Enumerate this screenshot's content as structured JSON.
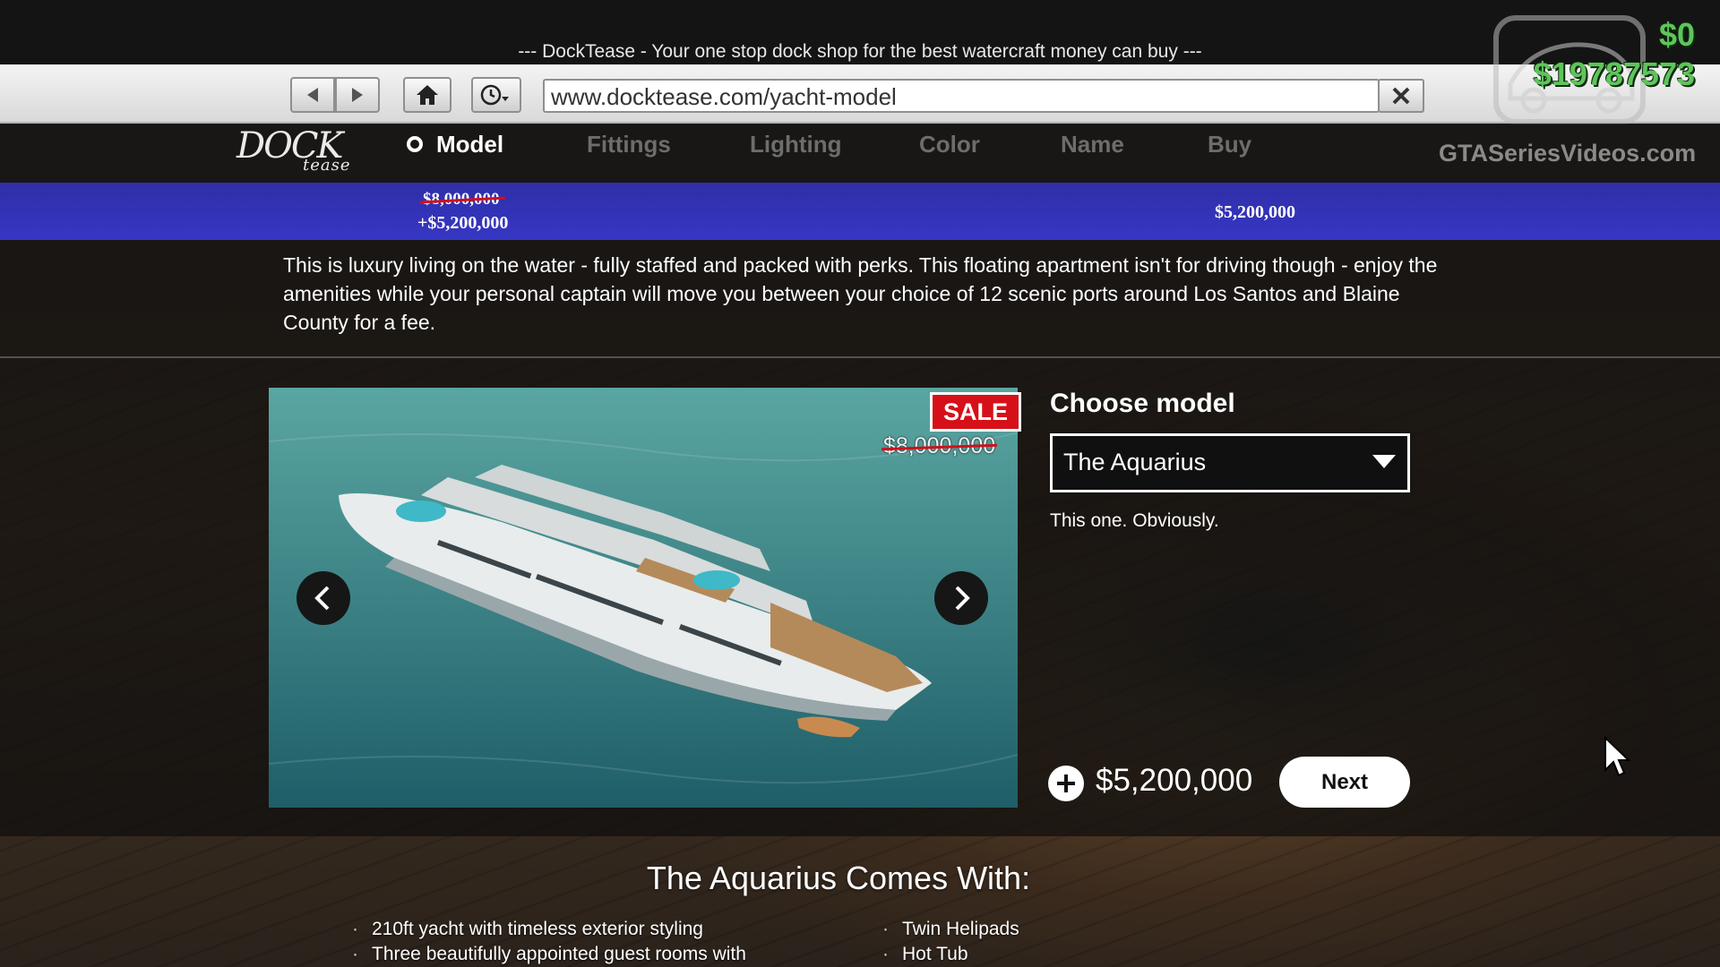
{
  "header": {
    "tagline": "--- DockTease - Your one stop dock shop for the best watercraft money can buy ---"
  },
  "browser": {
    "url": "www.docktease.com/yacht-model",
    "back_icon": "back-arrow-icon",
    "forward_icon": "forward-arrow-icon",
    "home_icon": "home-icon",
    "history_icon": "history-clock-icon",
    "close_icon": "close-x-icon"
  },
  "hud": {
    "cash": "$0",
    "bank": "$19787573",
    "cash_color": "#5fc45b"
  },
  "site": {
    "logo_main": "DOCK",
    "logo_sub": "tease",
    "watermark": "GTASeriesVideos.com",
    "steps": [
      {
        "label": "Model",
        "active": true
      },
      {
        "label": "Fittings",
        "active": false
      },
      {
        "label": "Lighting",
        "active": false
      },
      {
        "label": "Color",
        "active": false
      },
      {
        "label": "Name",
        "active": false
      },
      {
        "label": "Buy",
        "active": false
      }
    ]
  },
  "price_strip": {
    "old_price": "$8,000,000",
    "new_price": "+$5,200,000",
    "total": "$5,200,000",
    "color": "#3232b8"
  },
  "description": "This is luxury living on the water - fully staffed and packed with perks. This floating apartment isn't for driving though - enjoy the amenities while your personal captain will move you between your choice of 12 scenic ports around Los Santos and Blaine County for a fee.",
  "gallery": {
    "sale_label": "SALE",
    "old_price": "$8,000,000",
    "prev_icon": "chevron-left-icon",
    "next_icon": "chevron-right-icon"
  },
  "model_picker": {
    "title": "Choose model",
    "selected": "The Aquarius",
    "note": "This one. Obviously."
  },
  "purchase": {
    "price": "$5,200,000",
    "next_label": "Next"
  },
  "features": {
    "title": "The Aquarius Comes With:",
    "left": [
      "210ft yacht with timeless exterior styling",
      "Three beautifully appointed guest rooms with"
    ],
    "right": [
      "Twin Helipads",
      "Hot Tub"
    ]
  }
}
